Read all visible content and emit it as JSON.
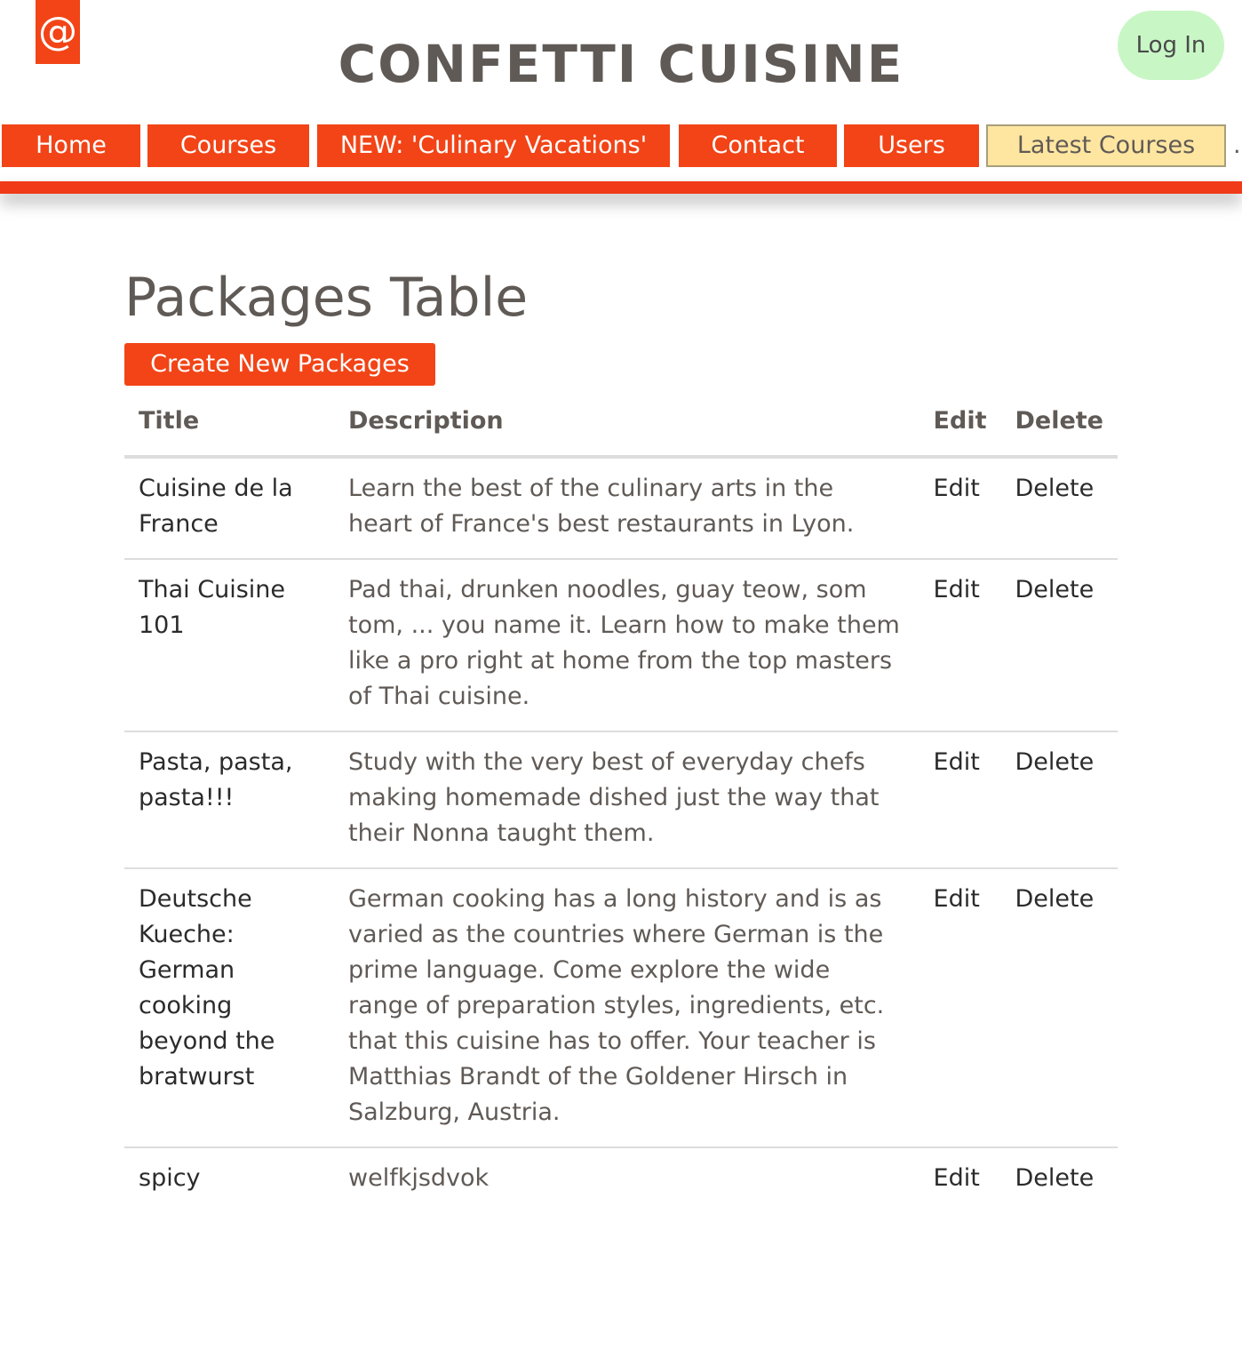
{
  "header": {
    "logo_glyph": "@",
    "site_title": "CONFETTI CUISINE",
    "login_label": "Log In"
  },
  "nav": {
    "items": [
      {
        "label": "Home"
      },
      {
        "label": "Courses"
      },
      {
        "label": "NEW: 'Culinary Vacations'"
      },
      {
        "label": "Contact"
      },
      {
        "label": "Users"
      },
      {
        "label": "Latest Courses"
      }
    ],
    "trailing": "."
  },
  "main": {
    "page_title": "Packages Table",
    "create_label": "Create New Packages",
    "table": {
      "headers": {
        "title": "Title",
        "description": "Description",
        "edit": "Edit",
        "delete": "Delete"
      },
      "rows": [
        {
          "title": "Cuisine de la France",
          "description": "Learn the best of the culinary arts in the heart of France's best restaurants in Lyon.",
          "edit": "Edit",
          "delete": "Delete"
        },
        {
          "title": "Thai Cuisine 101",
          "description": "Pad thai, drunken noodles, guay teow, som tom, ... you name it. Learn how to make them like a pro right at home from the top masters of Thai cuisine.",
          "edit": "Edit",
          "delete": "Delete"
        },
        {
          "title": "Pasta, pasta, pasta!!!",
          "description": "Study with the very best of everyday chefs making homemade dished just the way that their Nonna taught them.",
          "edit": "Edit",
          "delete": "Delete"
        },
        {
          "title": "Deutsche Kueche: German cooking beyond the bratwurst",
          "description": "German cooking has a long history and is as varied as the countries where German is the prime language. Come explore the wide range of preparation styles, ingredients, etc. that this cuisine has to offer. Your teacher is Matthias Brandt of the Goldener Hirsch in Salzburg, Austria.",
          "edit": "Edit",
          "delete": "Delete"
        },
        {
          "title": "spicy",
          "description": "welfkjsdvok",
          "edit": "Edit",
          "delete": "Delete"
        }
      ]
    }
  },
  "colors": {
    "accent": "#f24417",
    "bar": "#f03a18",
    "login_bg": "#c8f7c5",
    "latest_bg": "#ffe6a0",
    "text": "#605a56"
  }
}
